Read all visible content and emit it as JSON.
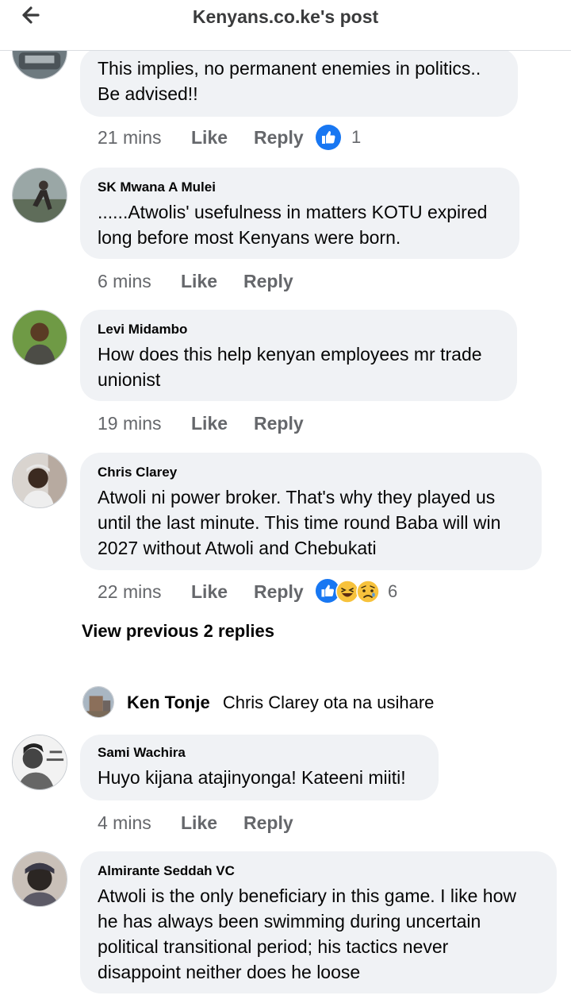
{
  "header": {
    "title": "Kenyans.co.ke's post",
    "back_icon": "back-arrow-icon"
  },
  "labels": {
    "like": "Like",
    "reply": "Reply"
  },
  "comments": [
    {
      "name": "",
      "lines": [
        "This implies, no permanent enemies in politics..",
        "Be advised!!"
      ],
      "time": "21 mins",
      "reaction_count": "1",
      "reactions": [
        "like"
      ]
    },
    {
      "name": "SK Mwana A Mulei",
      "lines": [
        "......Atwolis' usefulness in matters KOTU expired",
        "long before most Kenyans were born."
      ],
      "time": "6 mins"
    },
    {
      "name": "Levi Midambo",
      "lines": [
        "How does this help kenyan employees mr trade",
        "unionist"
      ],
      "time": "19 mins"
    },
    {
      "name": "Chris Clarey",
      "lines": [
        "Atwoli ni power broker. That's why they played us",
        "until the last minute. This time round Baba will win",
        "2027 without Atwoli and Chebukati"
      ],
      "time": "22 mins",
      "reaction_count": "6",
      "reactions": [
        "like",
        "haha",
        "sad"
      ]
    },
    {
      "name": "Sami Wachira",
      "lines": [
        "Huyo kijana atajinyonga! Kateeni miiti!"
      ],
      "time": "4 mins"
    },
    {
      "name": "Almirante Seddah VC",
      "lines": [
        "Atwoli is the only beneficiary in this game. I like how",
        "he has always been swimming during uncertain",
        "political transitional period; his tactics never",
        "disappoint neither does he loose"
      ]
    }
  ],
  "view_previous": "View previous 2 replies",
  "reply_preview": {
    "name": "Ken Tonje",
    "text": "Chris Clarey ota na usihare"
  },
  "colors": {
    "like_blue": "#1877f2",
    "bubble": "#f0f2f5",
    "muted": "#65676b",
    "haha_yellow": "#f7c23c"
  }
}
